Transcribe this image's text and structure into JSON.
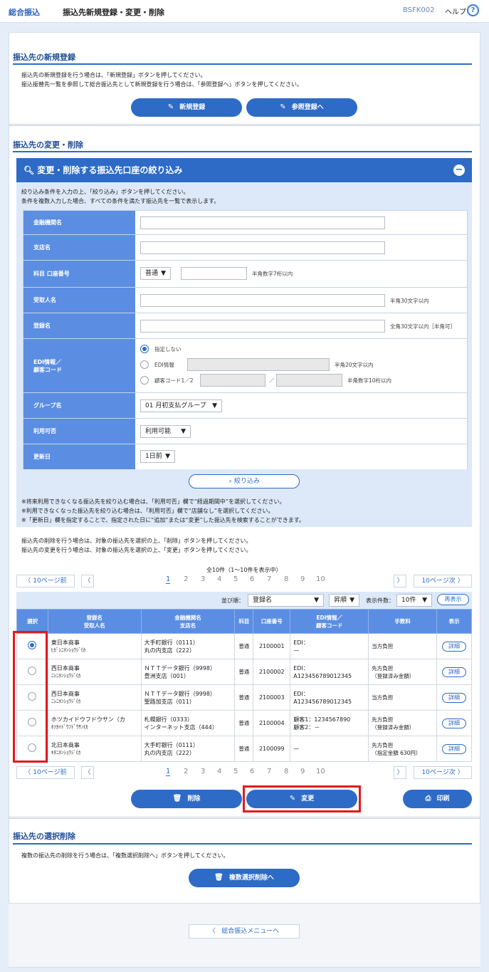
{
  "header": {
    "app_name": "総合振込",
    "page_title": "振込先新規登録・変更・削除",
    "screen_code": "BSFK002",
    "help_label": "ヘルプ",
    "help_icon": "?"
  },
  "new_section": {
    "title": "振込先の新規登録",
    "desc1": "振込先の新規登録を行う場合は、「新規登録」ボタンを押してください。",
    "desc2": "振込振替先一覧を参照して総合振込先として新規登録を行う場合は、「参照登録へ」ボタンを押してください。",
    "new_button": "新規登録",
    "ref_button": "参照登録へ"
  },
  "change_section": {
    "title": "振込先の変更・削除"
  },
  "filter": {
    "header": "変更・削除する振込先口座の絞り込み",
    "desc1": "絞り込み条件を入力の上、「絞り込み」ボタンを押してください。",
    "desc2": "条件を複数入力した場合、すべての条件を満たす振込先を一覧で表示します。",
    "labels": {
      "bank": "金融機関名",
      "branch": "支店名",
      "account": "科目 口座番号",
      "recipient": "受取人名",
      "reg_name": "登録名",
      "edi": "EDI情報／\n顧客コード",
      "group": "グループ名",
      "usable": "利用可否",
      "updated": "更新日"
    },
    "account_type": "普通",
    "account_hint": "半角数字7桁以内",
    "recipient_hint": "半角30文字以内",
    "reg_name_hint": "全角30文字以内［半角可］",
    "edi_opt1": "指定しない",
    "edi_opt2": "EDI情報",
    "edi_opt2_hint": "半角20文字以内",
    "edi_opt3": "顧客コード1／2",
    "edi_sep": "／",
    "edi_opt3_hint": "半角数字10桁以内",
    "group_value": "01 月初支払グループ",
    "usable_value": "利用可能",
    "updated_value": "1日前",
    "filter_button": "絞り込み",
    "note1": "※将来利用できなくなる振込先を絞り込む場合は、「利用可否」欄で“経過期間中”を選択してください。",
    "note2": "※利用できなくなった振込先を絞り込む場合は、「利用可否」欄で“店舗なし”を選択してください。",
    "note3": "※「更新日」欄を指定することで、指定された日に“追加”または“変更”した振込先を検索することができます。"
  },
  "instr1": "振込先の削除を行う場合は、対象の振込先を選択の上、「削除」ボタンを押してください。",
  "instr2": "振込先の変更を行う場合は、対象の振込先を選択の上、「変更」ボタンを押してください。",
  "pager": {
    "count_text": "全10件（1〜10件を表示中）",
    "prev10": "10ページ前",
    "next10": "10ページ次",
    "pages": [
      "1",
      "2",
      "3",
      "4",
      "5",
      "6",
      "7",
      "8",
      "9",
      "10"
    ]
  },
  "sortbar": {
    "sort_label": "並び順：",
    "sort_value": "登録名",
    "order_value": "昇順",
    "per_page_label": "表示件数：",
    "per_page_value": "10件",
    "redisplay": "再表示"
  },
  "table": {
    "headers": [
      "選択",
      "登録名\n受取人名",
      "金融機関名\n支店名",
      "科目",
      "口座番号",
      "EDI情報／\n顧客コード",
      "手数料",
      "表示"
    ],
    "detail_label": "詳細",
    "rows": [
      {
        "selected": true,
        "name": "東日本商事",
        "kana": "ﾋｶﾞｼﾆﾎﾝｼｮｳｼﾞ(ｶ",
        "bank": "大手町銀行（0111）",
        "branch": "丸の内支店（222）",
        "type": "普通",
        "acct": "2100001",
        "edi1": "EDI：",
        "edi2": "—",
        "fee1": "当方負担",
        "fee2": ""
      },
      {
        "selected": false,
        "name": "西日本商事",
        "kana": "ﾆｼﾆﾎﾝｼｮｳｼﾞ(ｶ",
        "bank": "ＮＴＴデータ銀行（9998）",
        "branch": "豊洲支店（001）",
        "type": "普通",
        "acct": "2100002",
        "edi1": "EDI：",
        "edi2": "A123456789012345",
        "fee1": "先方負担",
        "fee2": "（登録済み金額）"
      },
      {
        "selected": false,
        "name": "西日本商事",
        "kana": "ﾆｼﾆﾎﾝｼｮｳｼﾞ(ｶ",
        "bank": "ＮＴＴデータ銀行（9998）",
        "branch": "聖路加支店（011）",
        "type": "普通",
        "acct": "2100003",
        "edi1": "EDI：",
        "edi2": "A123456789012345",
        "fee1": "当方負担",
        "fee2": ""
      },
      {
        "selected": false,
        "name": "ホツカイドウフドウサン（カ",
        "kana": "ﾎﾂｶｲﾄﾞｳﾌﾄﾞｳｻﾝ(ｶ",
        "bank": "札幌銀行（0333）",
        "branch": "インターネット支店（444）",
        "type": "普通",
        "acct": "2100004",
        "edi1": "顧客1：1234567890",
        "edi2": "顧客2：－",
        "fee1": "先方負担",
        "fee2": "（登録済み金額）"
      },
      {
        "selected": false,
        "name": "北日本商事",
        "kana": "ｷﾀﾆﾎﾝｼｮｳｼﾞ(ｶ",
        "bank": "大手町銀行（0111）",
        "branch": "丸の内支店（222）",
        "type": "普通",
        "acct": "2100099",
        "edi1": "—",
        "edi2": "",
        "fee1": "先方負担",
        "fee2": "（指定金額 630円）"
      }
    ]
  },
  "actions": {
    "delete": "削除",
    "change": "変更",
    "print": "印刷"
  },
  "bulk": {
    "title": "振込先の選択削除",
    "desc": "複数の振込先の削除を行う場合は、「複数選択削除へ」ボタンを押してください。",
    "button": "複数選択削除へ"
  },
  "footer": {
    "back_button": "総合振込メニューへ"
  },
  "colors": {
    "accent": "#2d6bc6",
    "highlight": "#e2191e",
    "label_bg": "#5b8ee3"
  }
}
